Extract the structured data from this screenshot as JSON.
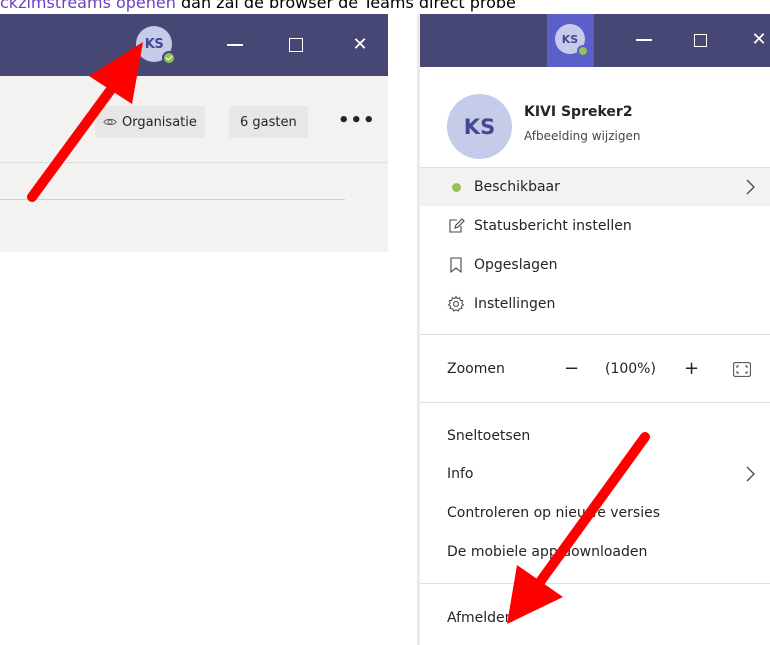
{
  "caption": {
    "link_text": "ckzimstreams openen",
    "rest_text": " dan zal de browser de Teams direct probe"
  },
  "left_window": {
    "avatar_initials": "KS",
    "org_label": "Organisatie",
    "guests_label": "6 gasten",
    "more_label": "•••"
  },
  "right_window": {
    "avatar_initials": "KS",
    "profile": {
      "initials": "KS",
      "name": "KIVI Spreker2",
      "change_picture": "Afbeelding wijzigen"
    },
    "status_items": [
      {
        "label": "Beschikbaar",
        "icon": "presence-available-dot"
      },
      {
        "label": "Statusbericht instellen",
        "icon": "edit-note-icon"
      },
      {
        "label": "Opgeslagen",
        "icon": "bookmark-icon"
      },
      {
        "label": "Instellingen",
        "icon": "gear-icon"
      }
    ],
    "zoom": {
      "label": "Zoomen",
      "minus": "−",
      "value": "(100%)",
      "plus": "+"
    },
    "help_items": [
      {
        "label": "Sneltoetsen"
      },
      {
        "label": "Info"
      },
      {
        "label": "Controleren op nieuwe versies"
      },
      {
        "label": "De mobiele app downloaden"
      }
    ],
    "sign_out": "Afmelden"
  },
  "colors": {
    "titlebar": "#464775",
    "accent": "#5b5fc7",
    "avatar_bg": "#c5cbe9",
    "presence_green": "#92c353",
    "arrow_red": "#ff0000"
  }
}
